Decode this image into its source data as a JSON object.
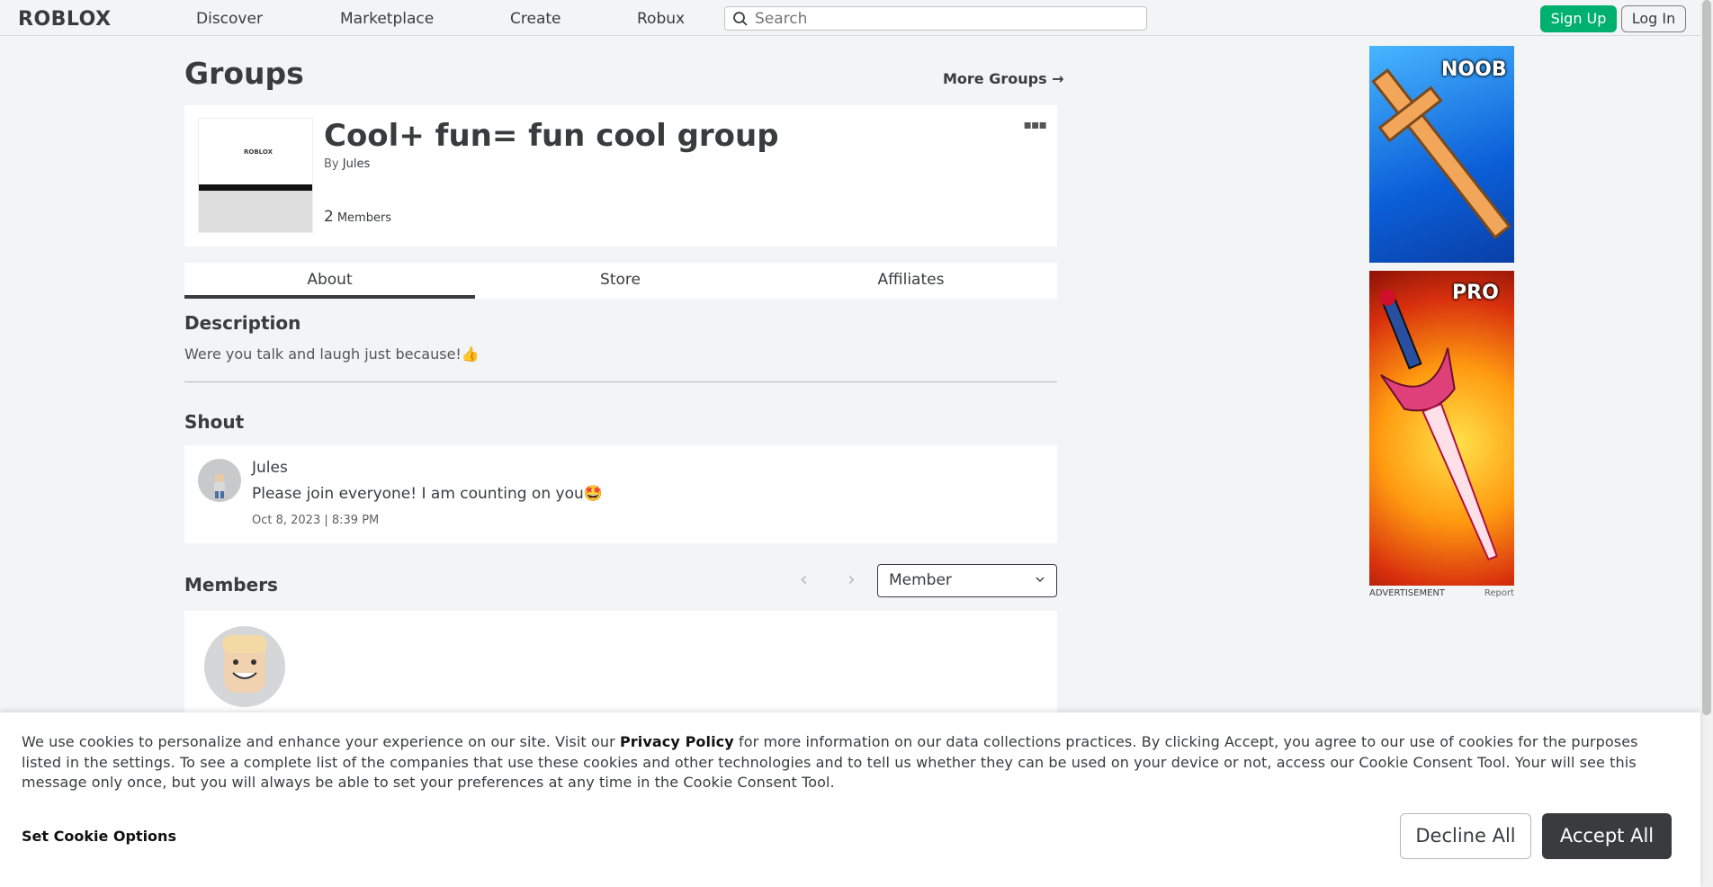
{
  "header": {
    "logo": "ROBLOX",
    "nav": [
      "Discover",
      "Marketplace",
      "Create",
      "Robux"
    ],
    "search_placeholder": "Search",
    "signup_label": "Sign Up",
    "login_label": "Log In"
  },
  "page": {
    "title": "Groups",
    "more_groups": "More Groups →"
  },
  "group": {
    "name": "Cool+ fun= fun cool group",
    "by_label": "By",
    "owner": "Jules",
    "member_count": "2",
    "members_label": "Members",
    "thumb_logo": "ROBLOX"
  },
  "tabs": [
    "About",
    "Store",
    "Affiliates"
  ],
  "about": {
    "description_title": "Description",
    "description": "Were you talk and laugh just because!👍",
    "shout_title": "Shout",
    "shout": {
      "author": "Jules",
      "message": "Please join everyone! I am counting on you🤩",
      "date": "Oct 8, 2023 | 8:39 PM"
    },
    "members_title": "Members",
    "role_select": "Member"
  },
  "ads": {
    "ad1_label": "NOOB",
    "ad2_label": "PRO",
    "advertisement": "ADVERTISEMENT",
    "report": "Report"
  },
  "cookie": {
    "text_before": "We use cookies to personalize and enhance your experience on our site. Visit our ",
    "privacy_link": "Privacy Policy",
    "text_after": " for more information on our data collections practices. By clicking Accept, you agree to our use of cookies for the purposes listed in the settings. To see a complete list of the companies that use these cookies and other technologies and to tell us whether they can be used on your device or not, access our Cookie Consent Tool. Your will see this message only once, but you will always be able to set your preferences at any time in the Cookie Consent Tool.",
    "settings_label": "Set Cookie Options",
    "decline_label": "Decline All",
    "accept_label": "Accept All"
  },
  "colors": {
    "accent_green": "#00b06f",
    "text_dark": "#393b3d",
    "background": "#f2f4f5"
  }
}
